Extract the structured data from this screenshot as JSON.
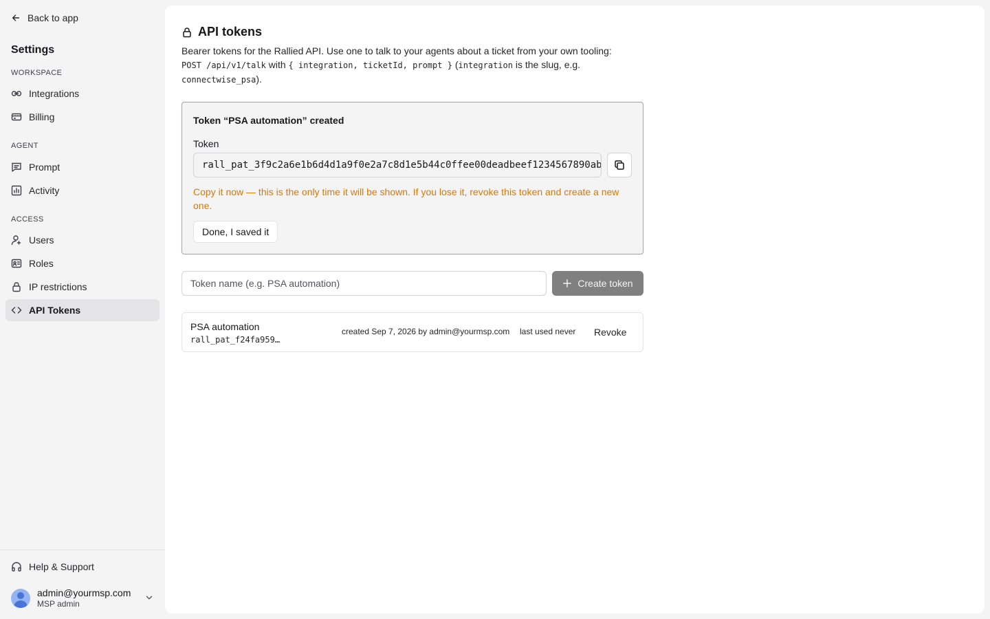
{
  "sidebar": {
    "back_label": "Back to app",
    "title": "Settings",
    "sections": {
      "workspace": "WORKSPACE",
      "agent": "AGENT",
      "access": "ACCESS"
    },
    "items": {
      "integrations": "Integrations",
      "billing": "Billing",
      "prompt": "Prompt",
      "activity": "Activity",
      "users": "Users",
      "roles": "Roles",
      "ip_restrictions": "IP restrictions",
      "api_tokens": "API Tokens"
    },
    "active_item": "api_tokens",
    "help_label": "Help & Support",
    "user": {
      "email": "admin@yourmsp.com",
      "role": "MSP admin"
    }
  },
  "page": {
    "title": "API tokens",
    "desc": {
      "line1": "Bearer tokens for the Rallied API. Use one to talk to your agents about a ticket from your own tooling:",
      "endpoint": "POST /api/v1/talk",
      "with": "with",
      "params": "{ integration, ticketId, prompt }",
      "paren_open": "(",
      "param_integration": "integration",
      "slug_text": "is the slug, e.g.",
      "slug_example": "connectwise_psa",
      "end": ")."
    },
    "created": {
      "title": "Token “PSA automation” created",
      "token_label": "Token",
      "token_value": "rall_pat_3f9c2a6e1b6d4d1a9f0e2a7c8d1e5b44c0ffee00deadbeef1234567890ab",
      "warning": "Copy it now — this is the only time it will be shown. If you lose it, revoke this token and create a new one.",
      "done_label": "Done, I saved it"
    },
    "create": {
      "placeholder": "Token name (e.g. PSA automation)",
      "button_label": "Create token"
    },
    "tokens": [
      {
        "name": "PSA automation",
        "prefix": "rall_pat_f24fa959…",
        "created": "created Sep 7, 2026 by admin@yourmsp.com",
        "last_used": "last used never",
        "revoke_label": "Revoke"
      }
    ]
  },
  "colors": {
    "warning": "#d97706",
    "create_button": "#808080",
    "active_nav": "#e4e4e7",
    "avatar": "#93b4f5"
  }
}
